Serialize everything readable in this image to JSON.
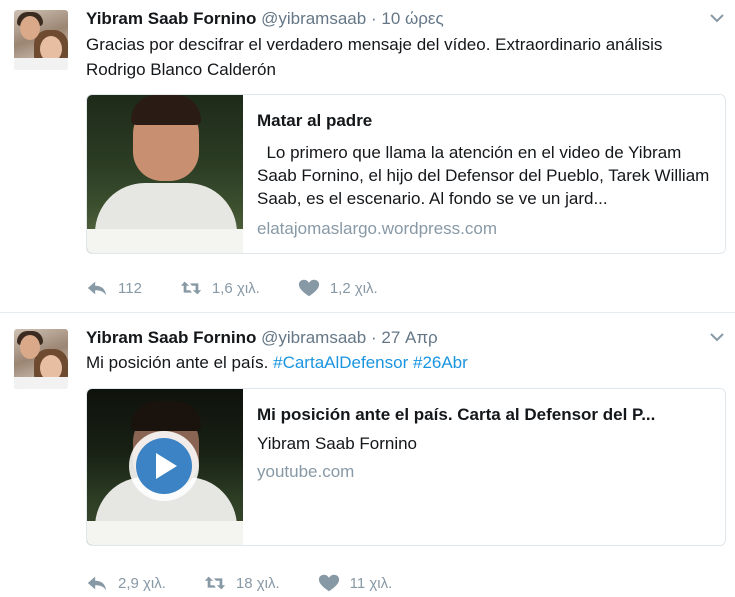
{
  "tweets": [
    {
      "name": "Yibram Saab Fornino",
      "handle": "@yibramsaab",
      "separator": "·",
      "time": "10 ώρες",
      "text": "Gracias por descifrar el verdadero mensaje del vídeo. Extraordinario análisis Rodrigo Blanco Calderón",
      "card": {
        "title": "Matar al padre",
        "description": "  Lo primero que llama la atención en el video de Yibram Saab Fornino, el hijo del Defensor del Pueblo, Tarek William Saab, es el escenario. Al fondo se ve un jard...",
        "domain": "elatajomaslargo.wordpress.com"
      },
      "actions": {
        "replies": "112",
        "retweets": "1,6 χιλ.",
        "likes": "1,2 χιλ."
      }
    },
    {
      "name": "Yibram Saab Fornino",
      "handle": "@yibramsaab",
      "separator": "·",
      "time": "27 Απρ",
      "text_plain": "Mi posición ante el país.",
      "hashtags": [
        "#CartaAlDefensor",
        "#26Abr"
      ],
      "card": {
        "title": "Mi posición ante el país. Carta al Defensor del P...",
        "description": "Yibram Saab Fornino",
        "domain": "youtube.com"
      },
      "actions": {
        "replies": "2,9 χιλ.",
        "retweets": "18 χιλ.",
        "likes": "11 χιλ."
      }
    }
  ],
  "icons": {
    "reply": "reply-icon",
    "retweet": "retweet-icon",
    "like": "heart-icon",
    "menu": "chevron-down-icon",
    "play": "play-icon"
  },
  "colors": {
    "link": "#1b95e0",
    "muted": "#8899a6",
    "play": "#3b83c4"
  }
}
